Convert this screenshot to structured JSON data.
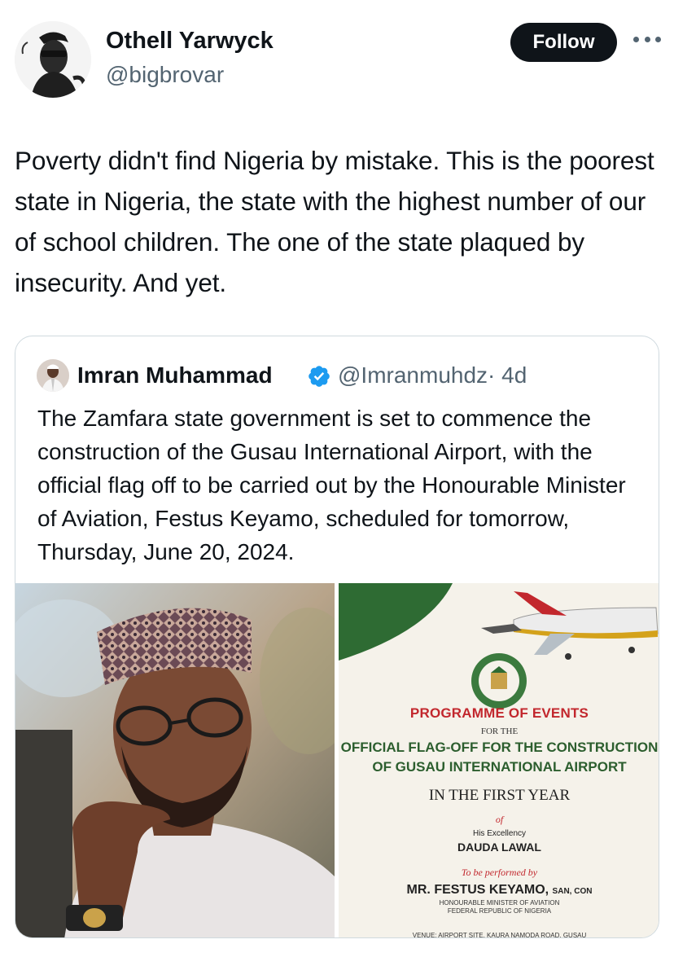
{
  "author": {
    "name": "Othell Yarwyck",
    "handle": "@bigbrovar"
  },
  "follow_label": "Follow",
  "tweet_text": "Poverty didn't find Nigeria by mistake. This is the poorest state in Nigeria, the state with the highest number of our of school children. The one of the state plaqued by insecurity. And yet.",
  "quote": {
    "name": "Imran Muhammad",
    "handle": "@Imranmuhdz",
    "separator": "·",
    "time": "4d",
    "text": "The Zamfara state government is set to commence the construction of the Gusau International Airport, with the official flag off to be carried out by the Honourable Minister of Aviation, Festus Keyamo, scheduled for tomorrow, Thursday, June 20, 2024.",
    "document": {
      "heading": "PROGRAMME OF EVENTS",
      "for_the": "FOR THE",
      "event_line1": "OFFICIAL FLAG-OFF FOR THE CONSTRUCTION",
      "event_line2": "OF GUSAU INTERNATIONAL AIRPORT",
      "year_line": "IN THE FIRST YEAR",
      "of": "of",
      "excellency": "His Excellency",
      "governor": "DAUDA LAWAL",
      "performed_by": "To be performed by",
      "minister": "MR. FESTUS KEYAMO,",
      "minister_suffix": "SAN, CON",
      "minister_title1": "HONOURABLE MINISTER OF AVIATION",
      "minister_title2": "FEDERAL REPUBLIC OF NIGERIA",
      "venue": "VENUE: AIRPORT SITE, KAURA NAMODA ROAD, GUSAU",
      "seal_text": "GOVERNMENT OF ZAMFARA STATE"
    }
  },
  "icons": {
    "more": "more-horizontal-icon",
    "verified": "verified-badge-icon"
  },
  "colors": {
    "text": "#0f1419",
    "secondary": "#536471",
    "follow_bg": "#0f1419",
    "verified": "#1d9bf0",
    "doc_red": "#c2272d",
    "doc_green": "#2c5e2e"
  }
}
